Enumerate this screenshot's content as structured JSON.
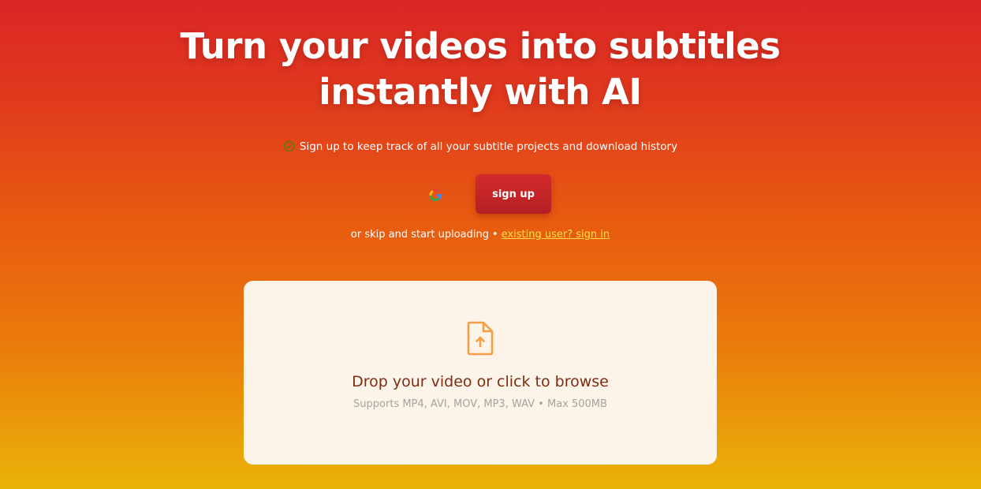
{
  "hero": {
    "title_line1": "Turn your videos into subtitles",
    "title_line2": "instantly with AI"
  },
  "benefit": {
    "icon": "check-circle-icon",
    "text": "Sign up to keep track of all your subtitle projects and download history"
  },
  "auth": {
    "google_icon": "google-icon",
    "signup_label": "sign up",
    "skip_text": "or skip and start uploading",
    "separator": "•",
    "signin_link": "existing user? sign in"
  },
  "dropzone": {
    "icon": "file-upload-icon",
    "title": "Drop your video or click to browse",
    "subtitle": "Supports MP4, AVI, MOV, MP3, WAV • Max 500MB"
  },
  "colors": {
    "gradient_top": "#dc2626",
    "gradient_bottom": "#eab308",
    "button": "#c62828",
    "link": "#fde047",
    "dropzone_bg": "#fcf3e9",
    "accent_orange": "#f59e42"
  }
}
